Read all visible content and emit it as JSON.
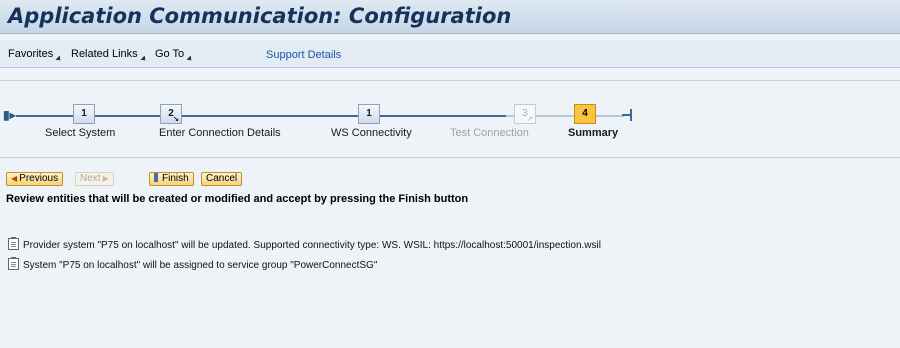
{
  "window": {
    "title": "Application Communication: Configuration"
  },
  "menubar": {
    "items": [
      {
        "label": "Favorites"
      },
      {
        "label": "Related Links"
      },
      {
        "label": "Go To"
      }
    ],
    "link": "Support Details"
  },
  "roadmap": {
    "steps": [
      {
        "number": "1",
        "label": "Select System",
        "state": "done"
      },
      {
        "number": "2",
        "label": "Enter Connection Details",
        "state": "done",
        "has_substeps": true
      },
      {
        "number": "1",
        "label": "WS Connectivity",
        "state": "done"
      },
      {
        "number": "3",
        "label": "Test Connection",
        "state": "disabled",
        "has_substeps": true
      },
      {
        "number": "4",
        "label": "Summary",
        "state": "active"
      }
    ]
  },
  "buttons": {
    "previous": "Previous",
    "next": "Next",
    "finish": "Finish",
    "cancel": "Cancel"
  },
  "instruction": "Review entities that will be created or modified and accept by pressing the Finish button",
  "messages": [
    "Provider system \"P75 on localhost\" will be updated. Supported connectivity type: WS. WSIL: https://localhost:50001/inspection.wsil",
    "System \"P75 on localhost\" will be assigned to service group \"PowerConnectSG\""
  ],
  "colors": {
    "title": "#14325a",
    "link": "#1c56a3",
    "active_step": "#f9c341",
    "button_border": "#c1902b"
  }
}
